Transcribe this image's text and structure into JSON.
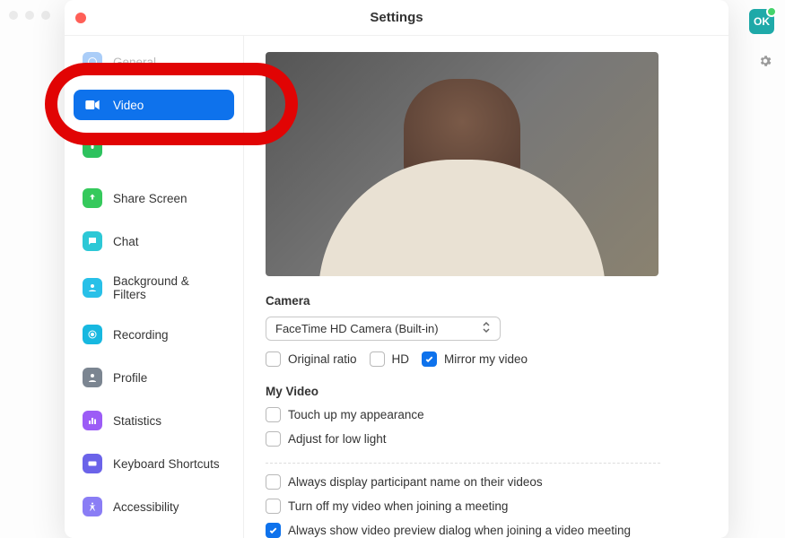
{
  "window": {
    "title": "Settings"
  },
  "profileInitials": "OK",
  "sidebar": {
    "items": [
      {
        "id": "general",
        "label": "General",
        "iconColor": "bluebg",
        "faded": true
      },
      {
        "id": "video",
        "label": "Video",
        "iconColor": "",
        "active": true
      },
      {
        "id": "audio",
        "label": "",
        "iconColor": "greenbg"
      },
      {
        "id": "share",
        "label": "Share Screen",
        "iconColor": "green2bg"
      },
      {
        "id": "chat",
        "label": "Chat",
        "iconColor": "tealbg"
      },
      {
        "id": "bgfilters",
        "label": "Background & Filters",
        "iconColor": "teal2bg"
      },
      {
        "id": "recording",
        "label": "Recording",
        "iconColor": "cyanbg"
      },
      {
        "id": "profile",
        "label": "Profile",
        "iconColor": "graybg"
      },
      {
        "id": "stats",
        "label": "Statistics",
        "iconColor": "purplebg"
      },
      {
        "id": "keyboard",
        "label": "Keyboard Shortcuts",
        "iconColor": "indigobg"
      },
      {
        "id": "accessibility",
        "label": "Accessibility",
        "iconColor": "lavbg"
      }
    ]
  },
  "video": {
    "sectionCamera": "Camera",
    "cameraSelected": "FaceTime HD Camera (Built-in)",
    "originalRatio": {
      "label": "Original ratio",
      "checked": false
    },
    "hd": {
      "label": "HD",
      "checked": false
    },
    "mirror": {
      "label": "Mirror my video",
      "checked": true
    },
    "sectionMyVideo": "My Video",
    "touchUp": {
      "label": "Touch up my appearance",
      "checked": false
    },
    "lowLight": {
      "label": "Adjust for low light",
      "checked": false
    },
    "alwaysName": {
      "label": "Always display participant name on their videos",
      "checked": false
    },
    "turnOff": {
      "label": "Turn off my video when joining a meeting",
      "checked": false
    },
    "alwaysPreview": {
      "label": "Always show video preview dialog when joining a video meeting",
      "checked": true
    }
  }
}
